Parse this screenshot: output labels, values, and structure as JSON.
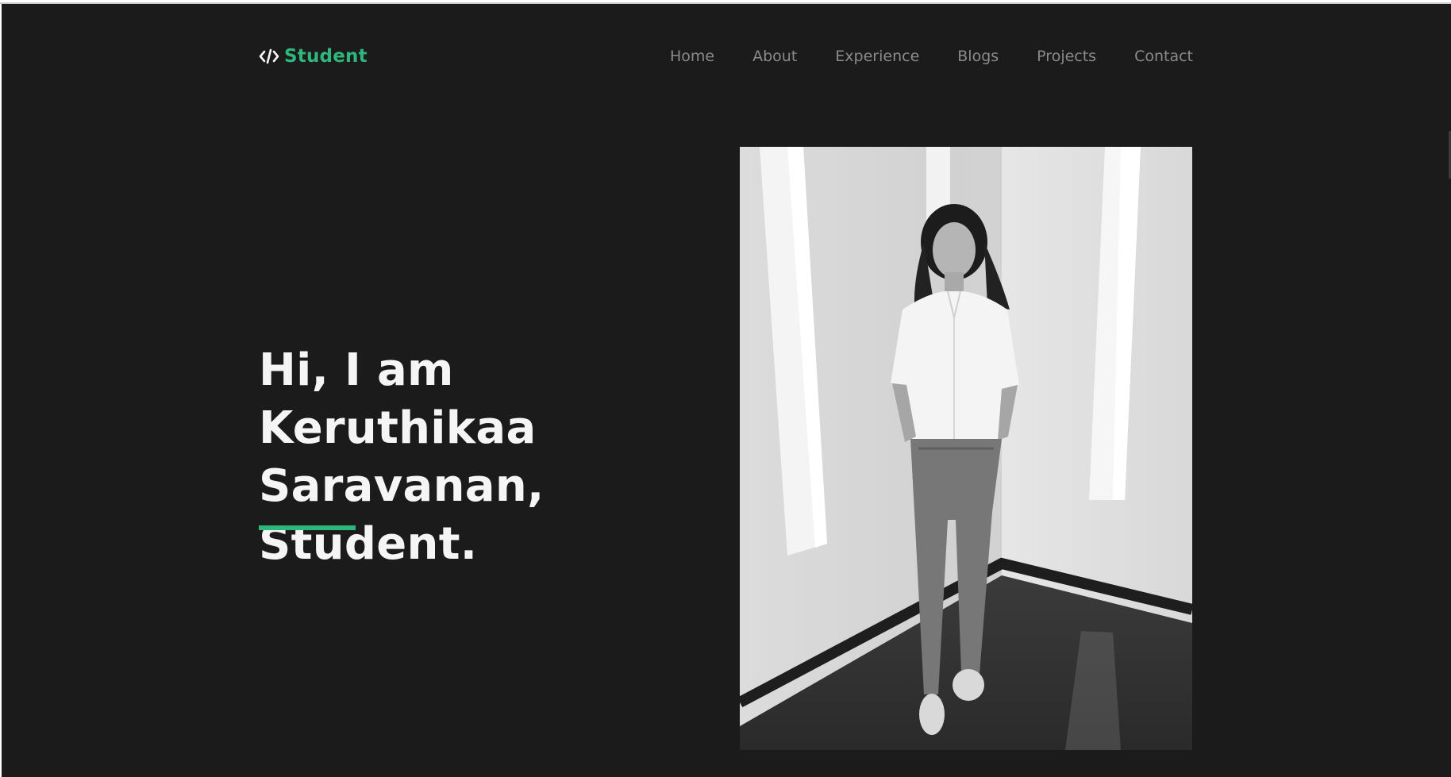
{
  "brand": {
    "label": "Student",
    "icon": "code-icon"
  },
  "nav": {
    "items": [
      {
        "label": "Home"
      },
      {
        "label": "About"
      },
      {
        "label": "Experience"
      },
      {
        "label": "Blogs"
      },
      {
        "label": "Projects"
      },
      {
        "label": "Contact"
      }
    ]
  },
  "hero": {
    "title_line1": "Hi, I am Keruthikaa",
    "title_line2": "Saravanan,",
    "title_line3": "Student."
  },
  "colors": {
    "background": "#1b1b1b",
    "accent": "#2eb67d",
    "text": "#f5f5f5",
    "nav_text": "#8b8b8b"
  }
}
